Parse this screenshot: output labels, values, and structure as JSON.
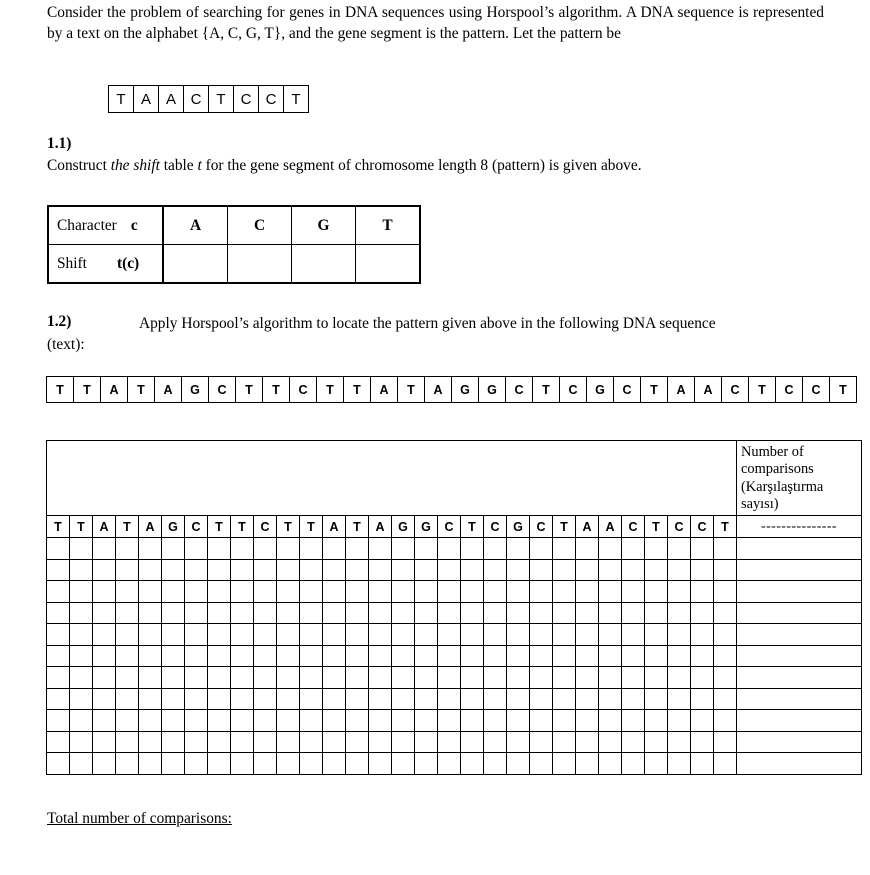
{
  "document": {
    "intro": {
      "line1": "Consider the problem of searching for genes in DNA sequences using Horspool’s algorithm. A DNA",
      "line2": "sequence is represented by a text on the alphabet {A, C, G, T}, and the gene segment is the pattern. Let the",
      "line3": "pattern be"
    },
    "pattern": {
      "characters": [
        "T",
        "A",
        "A",
        "C",
        "T",
        "C",
        "C",
        "T"
      ],
      "length": 8
    },
    "question_1_1": {
      "label": "1.1)",
      "text_before_italic": "Construct ",
      "italic_phrase": "the shift",
      "text_middle": " table ",
      "italic_t": "t",
      "text_after": " for the gene segment of chromosome length 8 (pattern) is given above."
    },
    "shift_table": {
      "row_labels": {
        "character_label": "Character",
        "character_symbol": "c",
        "shift_label": "Shift",
        "shift_symbol": "t(c)"
      },
      "alphabet": [
        "A",
        "C",
        "G",
        "T"
      ],
      "shift_values": [
        "",
        "",
        "",
        ""
      ]
    },
    "question_1_2": {
      "label": "1.2)",
      "text_line1": "Apply Horspool’s algorithm to locate the pattern given above in the following DNA sequence",
      "text_line2": "(text):"
    },
    "dna_text": {
      "characters": [
        "T",
        "T",
        "A",
        "T",
        "A",
        "G",
        "C",
        "T",
        "T",
        "C",
        "T",
        "T",
        "A",
        "T",
        "A",
        "G",
        "G",
        "C",
        "T",
        "C",
        "G",
        "C",
        "T",
        "A",
        "A",
        "C",
        "T",
        "C",
        "C",
        "T"
      ],
      "length": 30
    },
    "work_table": {
      "comparisons_header": {
        "line1": "Number of",
        "line2": "comparisons",
        "line3": "(Karşılaştırma",
        "line4": "sayısı)"
      },
      "first_row_comparisons": "---------------",
      "sequence_row": [
        "T",
        "T",
        "A",
        "T",
        "A",
        "G",
        "C",
        "T",
        "T",
        "C",
        "T",
        "T",
        "A",
        "T",
        "A",
        "G",
        "G",
        "C",
        "T",
        "C",
        "G",
        "C",
        "T",
        "A",
        "A",
        "C",
        "T",
        "C",
        "C",
        "T"
      ],
      "empty_row_count": 11
    },
    "footer": {
      "total_label": "Total number of comparisons:"
    }
  }
}
